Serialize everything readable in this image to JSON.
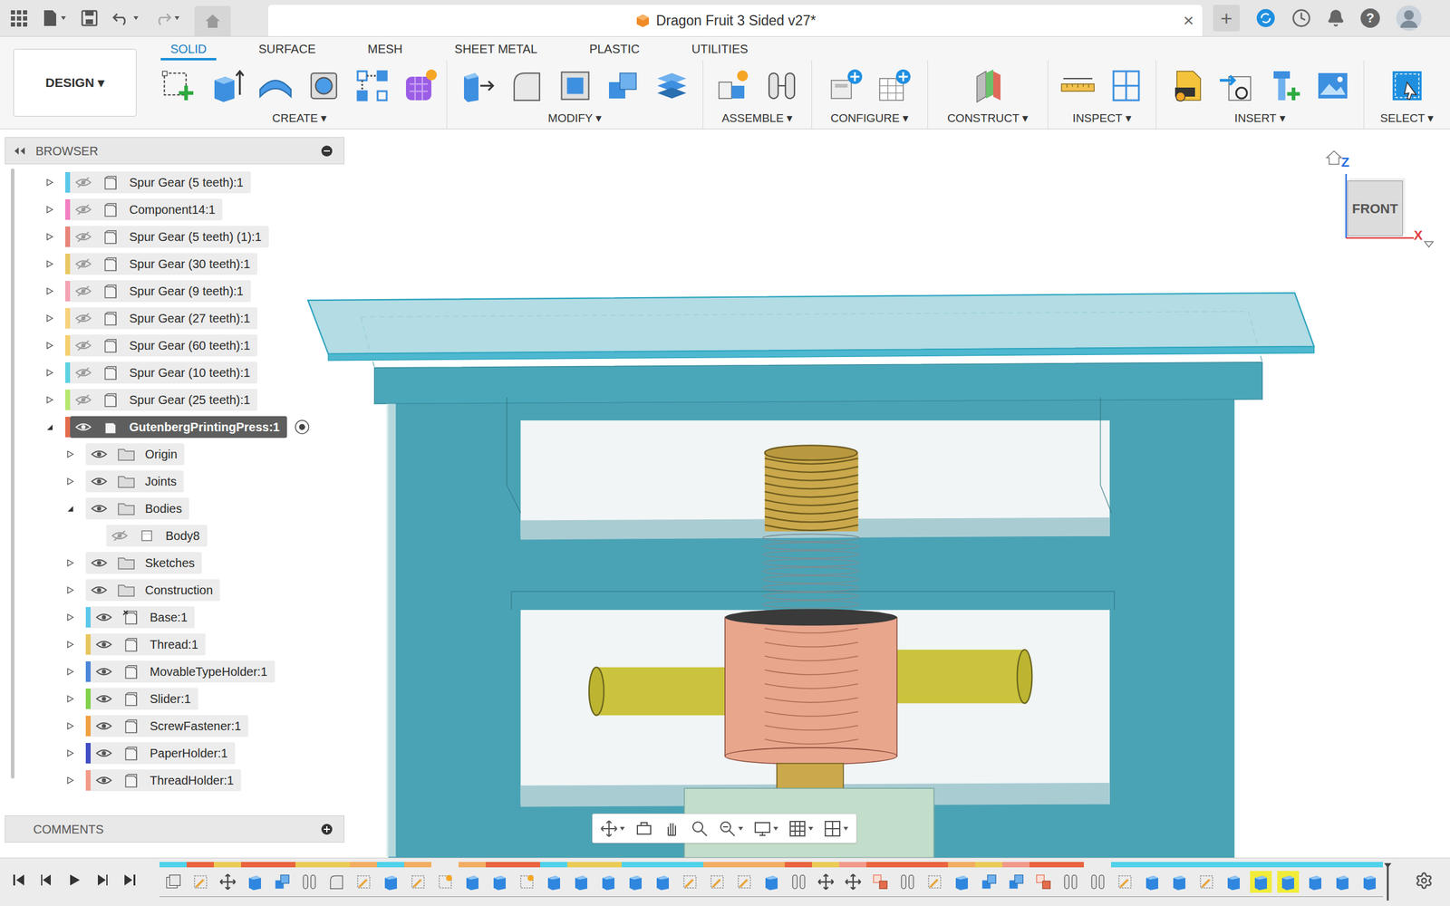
{
  "window": {
    "title": "Dragon Fruit 3 Sided v27*",
    "close": "×",
    "new_tab": "+",
    "help": "?"
  },
  "ribbon": {
    "workspace": "DESIGN ▾",
    "tabs": [
      {
        "label": "SOLID",
        "selected": true
      },
      {
        "label": "SURFACE",
        "selected": false
      },
      {
        "label": "MESH",
        "selected": false
      },
      {
        "label": "SHEET METAL",
        "selected": false
      },
      {
        "label": "PLASTIC",
        "selected": false
      },
      {
        "label": "UTILITIES",
        "selected": false
      }
    ],
    "groups": [
      {
        "label": "CREATE ▾",
        "tools": [
          "new-sketch",
          "extrude",
          "revolve",
          "hole",
          "pattern",
          "form"
        ]
      },
      {
        "label": "MODIFY ▾",
        "tools": [
          "press-pull",
          "fillet",
          "shell",
          "combine",
          "align"
        ]
      },
      {
        "label": "ASSEMBLE ▾",
        "tools": [
          "new-component",
          "joint"
        ]
      },
      {
        "label": "CONFIGURE ▾",
        "tools": [
          "configure",
          "table"
        ]
      },
      {
        "label": "CONSTRUCT ▾",
        "tools": [
          "plane"
        ]
      },
      {
        "label": "INSPECT ▾",
        "tools": [
          "measure",
          "section"
        ]
      },
      {
        "label": "INSERT ▾",
        "tools": [
          "svg",
          "insert-derive",
          "fastener",
          "canvas"
        ]
      },
      {
        "label": "SELECT ▾",
        "tools": [
          "select"
        ]
      }
    ]
  },
  "browser": {
    "title": "BROWSER",
    "items": [
      {
        "label": "Spur Gear (5 teeth):1",
        "level": 1,
        "kind": "component",
        "visible": false,
        "expandable": true,
        "expanded": false,
        "selected": false,
        "active": false,
        "color": "#5bc8ea"
      },
      {
        "label": "Component14:1",
        "level": 1,
        "kind": "component",
        "visible": false,
        "expandable": true,
        "expanded": false,
        "selected": false,
        "active": false,
        "color": "#f27fc0"
      },
      {
        "label": "Spur Gear (5 teeth) (1):1",
        "level": 1,
        "kind": "component",
        "visible": false,
        "expandable": true,
        "expanded": false,
        "selected": false,
        "active": false,
        "color": "#e8847a"
      },
      {
        "label": "Spur Gear (30 teeth):1",
        "level": 1,
        "kind": "component",
        "visible": false,
        "expandable": true,
        "expanded": false,
        "selected": false,
        "active": false,
        "color": "#e9c862"
      },
      {
        "label": "Spur Gear (9 teeth):1",
        "level": 1,
        "kind": "component",
        "visible": false,
        "expandable": true,
        "expanded": false,
        "selected": false,
        "active": false,
        "color": "#f4a3b4"
      },
      {
        "label": "Spur Gear (27 teeth):1",
        "level": 1,
        "kind": "component",
        "visible": false,
        "expandable": true,
        "expanded": false,
        "selected": false,
        "active": false,
        "color": "#f7d27c"
      },
      {
        "label": "Spur Gear (60 teeth):1",
        "level": 1,
        "kind": "component",
        "visible": false,
        "expandable": true,
        "expanded": false,
        "selected": false,
        "active": false,
        "color": "#f6cf6e"
      },
      {
        "label": "Spur Gear (10 teeth):1",
        "level": 1,
        "kind": "component",
        "visible": false,
        "expandable": true,
        "expanded": false,
        "selected": false,
        "active": false,
        "color": "#5dd3e2"
      },
      {
        "label": "Spur Gear (25 teeth):1",
        "level": 1,
        "kind": "component",
        "visible": false,
        "expandable": true,
        "expanded": false,
        "selected": false,
        "active": false,
        "color": "#b6e86e"
      },
      {
        "label": "GutenbergPrintingPress:1",
        "level": 1,
        "kind": "component",
        "visible": true,
        "expandable": true,
        "expanded": true,
        "selected": true,
        "active": true,
        "color": "#e46d4d"
      },
      {
        "label": "Origin",
        "level": 2,
        "kind": "folder",
        "visible": true,
        "expandable": true,
        "expanded": false,
        "selected": false,
        "active": false,
        "color": null
      },
      {
        "label": "Joints",
        "level": 2,
        "kind": "folder",
        "visible": true,
        "expandable": true,
        "expanded": false,
        "selected": false,
        "active": false,
        "color": null
      },
      {
        "label": "Bodies",
        "level": 2,
        "kind": "folder",
        "visible": true,
        "expandable": true,
        "expanded": true,
        "selected": false,
        "active": false,
        "color": null
      },
      {
        "label": "Body8",
        "level": 3,
        "kind": "body",
        "visible": false,
        "expandable": false,
        "expanded": false,
        "selected": false,
        "active": false,
        "color": null
      },
      {
        "label": "Sketches",
        "level": 2,
        "kind": "folder",
        "visible": true,
        "expandable": true,
        "expanded": false,
        "selected": false,
        "active": false,
        "color": null
      },
      {
        "label": "Construction",
        "level": 2,
        "kind": "folder",
        "visible": true,
        "expandable": true,
        "expanded": false,
        "selected": false,
        "active": false,
        "color": null
      },
      {
        "label": "Base:1",
        "level": 2,
        "kind": "grounded-component",
        "visible": true,
        "expandable": true,
        "expanded": false,
        "selected": false,
        "active": false,
        "color": "#5bc8ea"
      },
      {
        "label": "Thread:1",
        "level": 2,
        "kind": "component",
        "visible": true,
        "expandable": true,
        "expanded": false,
        "selected": false,
        "active": false,
        "color": "#e8c55c"
      },
      {
        "label": "MovableTypeHolder:1",
        "level": 2,
        "kind": "component",
        "visible": true,
        "expandable": true,
        "expanded": false,
        "selected": false,
        "active": false,
        "color": "#4b86d8"
      },
      {
        "label": "Slider:1",
        "level": 2,
        "kind": "component",
        "visible": true,
        "expandable": true,
        "expanded": false,
        "selected": false,
        "active": false,
        "color": "#7fd24a"
      },
      {
        "label": "ScrewFastener:1",
        "level": 2,
        "kind": "component",
        "visible": true,
        "expandable": true,
        "expanded": false,
        "selected": false,
        "active": false,
        "color": "#f0a040"
      },
      {
        "label": "PaperHolder:1",
        "level": 2,
        "kind": "component",
        "visible": true,
        "expandable": true,
        "expanded": false,
        "selected": false,
        "active": false,
        "color": "#3f4dc4"
      },
      {
        "label": "ThreadHolder:1",
        "level": 2,
        "kind": "component",
        "visible": true,
        "expandable": true,
        "expanded": false,
        "selected": false,
        "active": false,
        "color": "#f29a88"
      }
    ]
  },
  "comments": {
    "title": "COMMENTS"
  },
  "viewcube": {
    "face": "FRONT",
    "axes": [
      "Z",
      "X"
    ]
  },
  "timeline": {
    "features": [
      {
        "kind": "component",
        "color": "#4fd2ea",
        "highlighted": false
      },
      {
        "kind": "sketch",
        "color": "#e9643f",
        "highlighted": false
      },
      {
        "kind": "move",
        "color": "#ebcb55",
        "highlighted": false
      },
      {
        "kind": "extrude",
        "color": "#e9643f",
        "highlighted": false
      },
      {
        "kind": "combine",
        "color": "#e9643f",
        "highlighted": false
      },
      {
        "kind": "joint",
        "color": "#ebcb55",
        "highlighted": false
      },
      {
        "kind": "fillet",
        "color": "#ebcb55",
        "highlighted": false
      },
      {
        "kind": "sketch",
        "color": "#f2ad62",
        "highlighted": false
      },
      {
        "kind": "extrude",
        "color": "#4fd2ea",
        "highlighted": false
      },
      {
        "kind": "sketch",
        "color": "#f2ad62",
        "highlighted": false
      },
      {
        "kind": "param",
        "color": null,
        "highlighted": false
      },
      {
        "kind": "extrude",
        "color": "#f2ad62",
        "highlighted": false
      },
      {
        "kind": "extrude",
        "color": "#e9643f",
        "highlighted": false
      },
      {
        "kind": "param",
        "color": "#e9643f",
        "highlighted": false
      },
      {
        "kind": "extrude",
        "color": "#4fd2ea",
        "highlighted": false
      },
      {
        "kind": "extrude",
        "color": "#ebcb55",
        "highlighted": false
      },
      {
        "kind": "extrude",
        "color": "#ebcb55",
        "highlighted": false
      },
      {
        "kind": "extrude",
        "color": "#4fd2ea",
        "highlighted": false
      },
      {
        "kind": "extrude",
        "color": "#4fd2ea",
        "highlighted": false
      },
      {
        "kind": "sketch",
        "color": "#4fd2ea",
        "highlighted": false
      },
      {
        "kind": "sketch",
        "color": "#f2ad62",
        "highlighted": false
      },
      {
        "kind": "sketch",
        "color": "#f2ad62",
        "highlighted": false
      },
      {
        "kind": "extrude",
        "color": "#f2ad62",
        "highlighted": false
      },
      {
        "kind": "joint",
        "color": "#e9643f",
        "highlighted": false
      },
      {
        "kind": "move",
        "color": "#ebcb55",
        "highlighted": false
      },
      {
        "kind": "move",
        "color": "#f2998a",
        "highlighted": false
      },
      {
        "kind": "rigid",
        "color": "#e9643f",
        "highlighted": false
      },
      {
        "kind": "joint",
        "color": "#e9643f",
        "highlighted": false
      },
      {
        "kind": "sketch",
        "color": "#e9643f",
        "highlighted": false
      },
      {
        "kind": "extrude",
        "color": "#f2ad62",
        "highlighted": false
      },
      {
        "kind": "combine",
        "color": "#ebcb55",
        "highlighted": false
      },
      {
        "kind": "combine",
        "color": "#f2998a",
        "highlighted": false
      },
      {
        "kind": "rigid",
        "color": "#e9643f",
        "highlighted": false
      },
      {
        "kind": "joint",
        "color": "#e9643f",
        "highlighted": false
      },
      {
        "kind": "joint",
        "color": null,
        "highlighted": false
      },
      {
        "kind": "sketch",
        "color": "#4fd2ea",
        "highlighted": false
      },
      {
        "kind": "extrude",
        "color": "#4fd2ea",
        "highlighted": false
      },
      {
        "kind": "extrude",
        "color": "#4fd2ea",
        "highlighted": false
      },
      {
        "kind": "sketch",
        "color": "#4fd2ea",
        "highlighted": false
      },
      {
        "kind": "extrude",
        "color": "#4fd2ea",
        "highlighted": false
      },
      {
        "kind": "extrude",
        "color": "#4fd2ea",
        "highlighted": true
      },
      {
        "kind": "extrude",
        "color": "#4fd2ea",
        "highlighted": true
      },
      {
        "kind": "extrude",
        "color": "#4fd2ea",
        "highlighted": false
      },
      {
        "kind": "extrude",
        "color": "#4fd2ea",
        "highlighted": false
      },
      {
        "kind": "extrude",
        "color": "#4fd2ea",
        "highlighted": false
      }
    ]
  }
}
